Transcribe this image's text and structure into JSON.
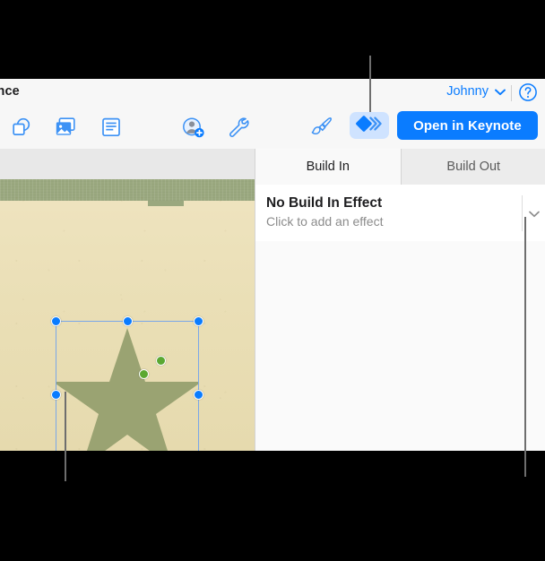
{
  "window": {
    "document_title": "ssance",
    "account_name": "Johnny",
    "account_chevron": "chevron-down",
    "help_icon": "help-circle-icon"
  },
  "toolbar": {
    "items": [
      {
        "name": "shape-tool",
        "icon": "shape-icon",
        "label": "Shape"
      },
      {
        "name": "media-tool",
        "icon": "media-image-icon",
        "label": "Media"
      },
      {
        "name": "text-tool",
        "icon": "text-box-icon",
        "label": "Text"
      },
      {
        "name": "collaborate-tool",
        "icon": "add-person-icon",
        "label": "Collaborate"
      },
      {
        "name": "tools-tool",
        "icon": "wrench-icon",
        "label": "Tools"
      },
      {
        "name": "format-tool",
        "icon": "paintbrush-icon",
        "label": "Format"
      }
    ],
    "animate_button": {
      "icon": "animate-diamond-icon",
      "label": "Animate",
      "selected": true
    },
    "open_in_keynote_label": "Open in Keynote"
  },
  "panel": {
    "tabs": [
      {
        "label": "Build In",
        "active": true
      },
      {
        "label": "Build Out",
        "active": false
      }
    ],
    "effect": {
      "title": "No Build In Effect",
      "subtitle": "Click to add an effect",
      "disclosure_icon": "chevron-down-icon"
    }
  },
  "canvas": {
    "selected_object": "star-shape",
    "selection_handles": 8,
    "adjust_handles": 2
  },
  "colors": {
    "accent_blue": "#0a7cff",
    "animate_button_bg": "#cfe3ff",
    "star_fill": "#9aa372",
    "band_green": "#9aa87f",
    "paper": "#eadfb6",
    "handle_green": "#5aa832",
    "callout_gray": "#6e6e6e"
  },
  "callouts": [
    {
      "name": "callout-line-animate-button"
    },
    {
      "name": "callout-line-star-object"
    },
    {
      "name": "callout-line-effect-disclosure"
    }
  ]
}
